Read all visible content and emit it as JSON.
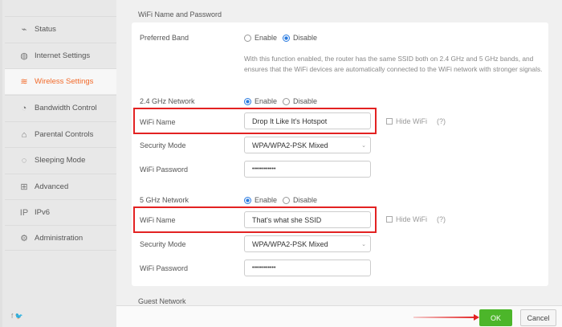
{
  "sidebar": {
    "items": [
      {
        "label": "Status",
        "icon": "status-icon"
      },
      {
        "label": "Internet Settings",
        "icon": "globe-icon"
      },
      {
        "label": "Wireless Settings",
        "icon": "wifi-icon",
        "active": true
      },
      {
        "label": "Bandwidth Control",
        "icon": "gauge-icon"
      },
      {
        "label": "Parental Controls",
        "icon": "house-icon"
      },
      {
        "label": "Sleeping Mode",
        "icon": "sleep-icon"
      },
      {
        "label": "Advanced",
        "icon": "grid-icon"
      },
      {
        "label": "IPv6",
        "icon": "ipv6-icon"
      },
      {
        "label": "Administration",
        "icon": "gear-icon"
      }
    ],
    "social": "f  🐦"
  },
  "section_title": "WiFi Name and Password",
  "preferred_band": {
    "label": "Preferred Band",
    "enable": "Enable",
    "disable": "Disable",
    "selected": "Disable",
    "description": "With this function enabled, the router has the same SSID both on 2.4 GHz and 5 GHz bands, and ensures that the WiFi devices are automatically connected to the WiFi network with stronger signals."
  },
  "band24": {
    "label": "2.4 GHz Network",
    "enable": "Enable",
    "disable": "Disable",
    "selected": "Enable",
    "wifi_name_label": "WiFi Name",
    "wifi_name": "Drop It Like It's Hotspot",
    "hide_wifi": "Hide WiFi",
    "help": "(?)",
    "security_label": "Security Mode",
    "security": "WPA/WPA2-PSK Mixed",
    "password_label": "WiFi Password",
    "password": "••••••••••••"
  },
  "band5": {
    "label": "5 GHz Network",
    "enable": "Enable",
    "disable": "Disable",
    "selected": "Enable",
    "wifi_name_label": "WiFi Name",
    "wifi_name": "That's what she SSID",
    "hide_wifi": "Hide WiFi",
    "help": "(?)",
    "security_label": "Security Mode",
    "security": "WPA/WPA2-PSK Mixed",
    "password_label": "WiFi Password",
    "password": "••••••••••••"
  },
  "guest_network": "Guest Network",
  "footer": {
    "ok": "OK",
    "cancel": "Cancel"
  },
  "colors": {
    "accent": "#f26a2a",
    "ok": "#4cb62a",
    "highlight": "#e32222",
    "radio": "#2a7be0"
  }
}
